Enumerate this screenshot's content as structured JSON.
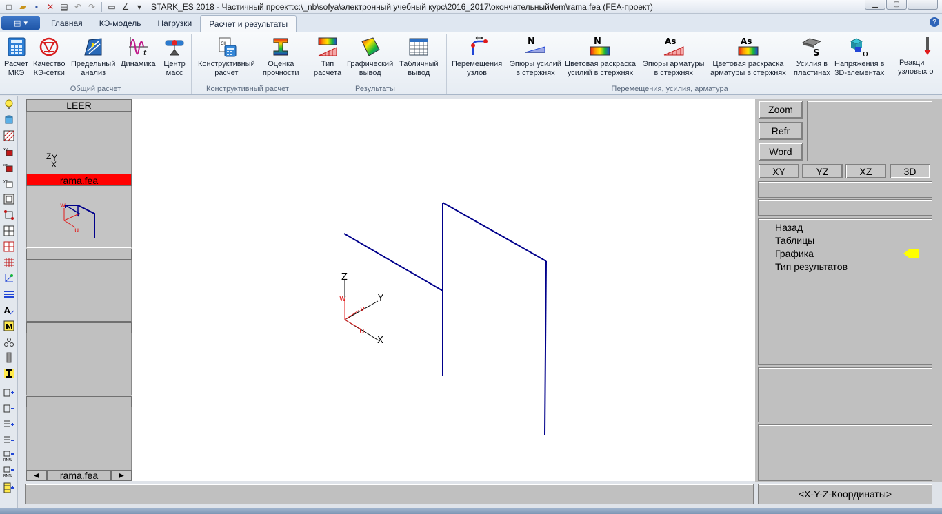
{
  "titlebar": {
    "title": "STARK_ES 2018 - Частичный проект:c:\\_nb\\sofya\\электронный учебный курс\\2016_2017\\окончательный\\fem\\rama.fea  (FEA-проект)"
  },
  "ribbon": {
    "tabs": [
      "Главная",
      "КЭ-модель",
      "Нагрузки",
      "Расчет и результаты"
    ],
    "active_tab": "Расчет и результаты",
    "groups": {
      "general": "Общий расчет",
      "constructive": "Конструктивный расчет",
      "results": "Результаты",
      "displacements": "Перемещения, усилия, арматура"
    },
    "buttons": {
      "calc_fem": [
        "Расчет",
        "МКЭ"
      ],
      "mesh_quality": [
        "Качество",
        "КЭ-сетки"
      ],
      "limit_analysis": [
        "Предельный",
        "анализ"
      ],
      "dynamics": [
        "Динамика",
        ""
      ],
      "center_mass": [
        "Центр",
        "масс"
      ],
      "constructive_calc": [
        "Конструктивный",
        "расчет"
      ],
      "strength_eval": [
        "Оценка",
        "прочности"
      ],
      "calc_type": [
        "Тип",
        "расчета"
      ],
      "graphic_output": [
        "Графический",
        "вывод"
      ],
      "table_output": [
        "Табличный",
        "вывод"
      ],
      "node_displacements": [
        "Перемещения",
        "узлов"
      ],
      "force_diagrams": [
        "Эпюры усилий",
        "в стержнях"
      ],
      "force_color": [
        "Цветовая раскраска",
        "усилий в стержнях"
      ],
      "rebar_diagrams": [
        "Эпюры арматуры",
        "в стержнях"
      ],
      "rebar_color": [
        "Цветовая раскраска",
        "арматуры в стержнях"
      ],
      "plate_forces": [
        "Усилия в",
        "пластинах"
      ],
      "stress_3d": [
        "Напряжения в",
        "3D-элементах"
      ],
      "node_reactions": [
        "Реакци",
        "узловых о"
      ]
    },
    "icon_text": {
      "n": "N",
      "as": "As",
      "s": "S",
      "sigma": "σ",
      "t": "t",
      "cii": "CII"
    }
  },
  "left_panel": {
    "header": "LEER",
    "axis_z": "Z",
    "axis_y": "Y",
    "axis_x": "X",
    "selected_file": "rama.fea",
    "thumb_w": "w",
    "thumb_u": "u",
    "nav_prev": "◀",
    "nav_next": "▶",
    "nav_file": "rama.fea"
  },
  "canvas": {
    "axis_labels": {
      "z": "Z",
      "y": "Y",
      "x": "X",
      "w": "w",
      "v": "v",
      "u": "u"
    }
  },
  "right_panel": {
    "buttons": {
      "zoom": "Zoom",
      "refr": "Refr",
      "word": "Word"
    },
    "views": [
      "XY",
      "YZ",
      "XZ",
      "3D"
    ],
    "menu": [
      "Назад",
      "Таблицы",
      "Графика",
      "Тип результатов"
    ]
  },
  "status": {
    "coords": "<X-Y-Z-Координаты>"
  },
  "colors": {
    "structure": "#00008b",
    "selected": "#ff0000",
    "pointer": "#ffff00"
  }
}
